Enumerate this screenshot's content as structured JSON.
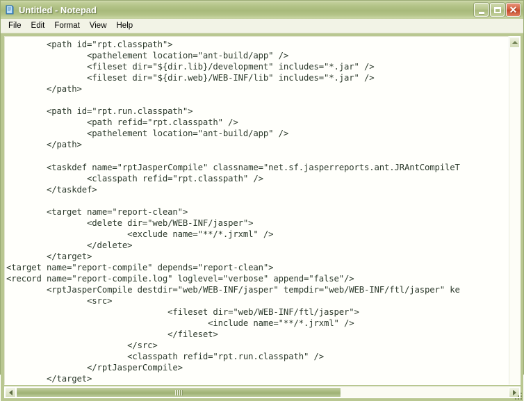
{
  "window": {
    "title": "Untitled - Notepad",
    "icon": "notepad-icon",
    "theme_accent": "#a8ba7b",
    "close_accent": "#c5492a",
    "caption_buttons": [
      {
        "name": "minimize",
        "label": "_"
      },
      {
        "name": "maximize",
        "label": "□"
      },
      {
        "name": "close",
        "label": "✕"
      }
    ]
  },
  "menubar": {
    "items": [
      {
        "label": "File"
      },
      {
        "label": "Edit"
      },
      {
        "label": "Format"
      },
      {
        "label": "View"
      },
      {
        "label": "Help"
      }
    ]
  },
  "editor": {
    "text_color": "#2c3a2c",
    "background": "#fffffb",
    "content": "        <path id=\"rpt.classpath\">\n                <pathelement location=\"ant-build/app\" />\n                <fileset dir=\"${dir.lib}/development\" includes=\"*.jar\" />\n                <fileset dir=\"${dir.web}/WEB-INF/lib\" includes=\"*.jar\" />\n        </path>\n\n        <path id=\"rpt.run.classpath\">\n                <path refid=\"rpt.classpath\" />\n                <pathelement location=\"ant-build/app\" />\n        </path>\n\n        <taskdef name=\"rptJasperCompile\" classname=\"net.sf.jasperreports.ant.JRAntCompileT\n                <classpath refid=\"rpt.classpath\" />\n        </taskdef>\n\n        <target name=\"report-clean\">\n                <delete dir=\"web/WEB-INF/jasper\">\n                        <exclude name=\"**/*.jrxml\" />\n                </delete>\n        </target>\n<target name=\"report-compile\" depends=\"report-clean\">\n<record name=\"report-compile.log\" loglevel=\"verbose\" append=\"false\"/>\n        <rptJasperCompile destdir=\"web/WEB-INF/jasper\" tempdir=\"web/WEB-INF/ftl/jasper\" ke\n                <src>\n                                <fileset dir=\"web/WEB-INF/ftl/jasper\">\n                                        <include name=\"**/*.jrxml\" />\n                                </fileset>\n                        </src>\n                        <classpath refid=\"rpt.run.classpath\" />\n                </rptJasperCompile>\n        </target>"
  },
  "scrollbars": {
    "vertical": {
      "up_arrow": "scroll-up-arrow",
      "down_arrow": "scroll-down-arrow"
    },
    "horizontal": {
      "left_arrow": "scroll-left-arrow",
      "right_arrow": "scroll-right-arrow",
      "thumb_name": "horizontal-scroll-thumb"
    }
  }
}
